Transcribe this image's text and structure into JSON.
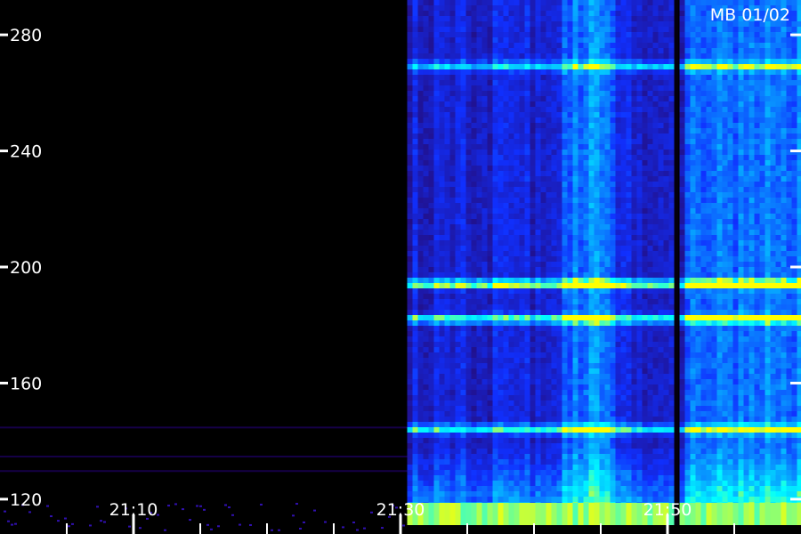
{
  "chart_data": {
    "type": "heatmap",
    "title": "MB 01/02",
    "y_ticks": [
      120,
      160,
      200,
      240,
      280
    ],
    "y_tick_labels": [
      "120",
      "160",
      "200",
      "240",
      "280"
    ],
    "ylim": [
      108,
      292
    ],
    "x_major_labels": [
      "21:10",
      "21:30",
      "21:50"
    ],
    "xlim_minutes": [
      1260,
      1320
    ],
    "x_minor_step_minutes": 5,
    "data_start_minute": 1290.5,
    "gap_minutes": [
      1310.5,
      1310.8
    ],
    "horizontal_bands": [
      {
        "center": 195,
        "intensity": 0.75
      },
      {
        "center": 183,
        "intensity": 0.65
      },
      {
        "center": 145,
        "intensity": 0.55
      },
      {
        "center": 270,
        "intensity": 0.45
      }
    ],
    "bright_column_ranges": [
      [
        1302,
        1306
      ],
      [
        1311,
        1320
      ]
    ],
    "colors": {
      "background": "#000000",
      "low": "#2a0050",
      "mid": "#1030ff",
      "high": "#00ffff",
      "max": "#ffff00",
      "text": "#ffffff"
    }
  }
}
